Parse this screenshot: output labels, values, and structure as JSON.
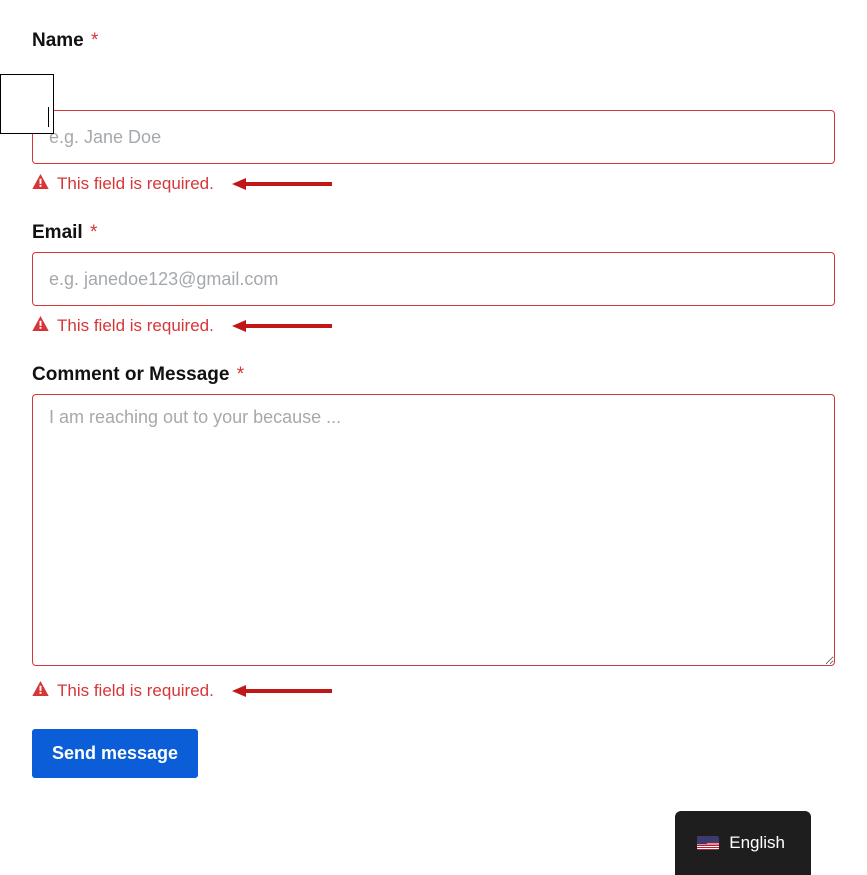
{
  "form": {
    "name": {
      "label": "Name",
      "required_marker": "*",
      "placeholder": "e.g. Jane Doe",
      "value": "",
      "error": "This field is required."
    },
    "email": {
      "label": "Email",
      "required_marker": "*",
      "placeholder": "e.g. janedoe123@gmail.com",
      "value": "",
      "error": "This field is required."
    },
    "message": {
      "label": "Comment or Message",
      "required_marker": "*",
      "placeholder": "I am reaching out to your because ...",
      "value": "",
      "error": "This field is required."
    },
    "submit_label": "Send message"
  },
  "language_selector": {
    "label": "English"
  },
  "colors": {
    "error": "#d63638",
    "primary": "#0b5ed7",
    "lang_bg": "#1e1e1e"
  }
}
